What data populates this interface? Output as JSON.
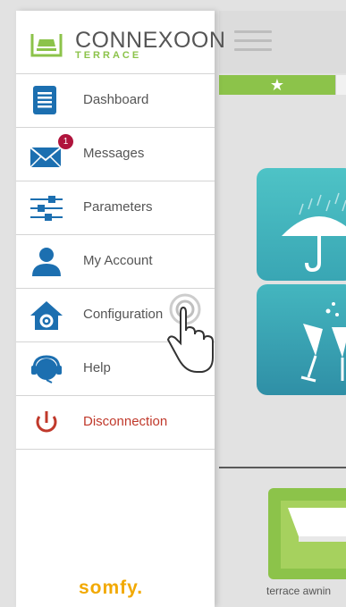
{
  "app": {
    "brand_text": "CONNEXOON",
    "brand_sub": "TERRACE",
    "footer_brand": "somfy."
  },
  "menu": {
    "items": [
      {
        "label": "Dashboard",
        "icon": "document-icon"
      },
      {
        "label": "Messages",
        "icon": "envelope-icon",
        "badge": "1"
      },
      {
        "label": "Parameters",
        "icon": "sliders-icon"
      },
      {
        "label": "My Account",
        "icon": "person-icon"
      },
      {
        "label": "Configuration",
        "icon": "house-gear-icon"
      },
      {
        "label": "Help",
        "icon": "headset-icon"
      },
      {
        "label": "Disconnection",
        "icon": "power-icon"
      }
    ]
  },
  "background": {
    "favorites_star": "★",
    "device_caption": "terrace awnin"
  },
  "colors": {
    "accent_blue": "#1c6fb0",
    "accent_green": "#8cc34a",
    "danger": "#c0392b",
    "badge": "#b0143c",
    "somfy": "#f2a900"
  }
}
